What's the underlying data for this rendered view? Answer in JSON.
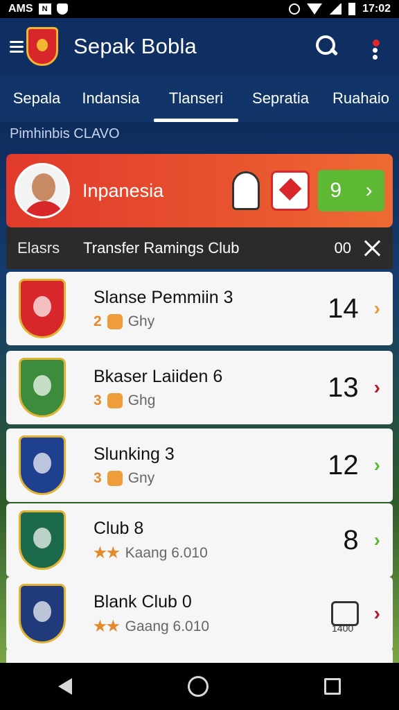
{
  "status_bar": {
    "carrier": "AMS",
    "time": "17:02",
    "box_icon_letter": "N"
  },
  "app_bar": {
    "title": "Sepak Bobla"
  },
  "tabs": [
    {
      "label": "Sepala"
    },
    {
      "label": "Indansia"
    },
    {
      "label": "Tlanseri",
      "active": true
    },
    {
      "label": "Sepratia"
    },
    {
      "label": "Ruahaio"
    }
  ],
  "section_label": "Pimhinbis CLAVO",
  "featured": {
    "title": "Inpanesia",
    "action_icon": "9",
    "chevron": "›"
  },
  "strip": {
    "tag": "Elasrs",
    "title": "Transfer Ramings Club",
    "count": "00"
  },
  "items": [
    {
      "name": "Slanse Pemmiin 3",
      "meta_num": "2",
      "meta_text": "Ghy",
      "score": "14",
      "chevron": "›",
      "chevron_color": "#e29a3b"
    },
    {
      "name": "Bkaser Laiiden 6",
      "meta_num": "3",
      "meta_text": "Ghg",
      "score": "13",
      "chevron": "›",
      "chevron_color": "#b1182a"
    },
    {
      "name": "Slunking 3",
      "meta_num": "3",
      "meta_text": "Gny",
      "score": "12",
      "chevron": "›",
      "chevron_color": "#5db833"
    },
    {
      "name": "Club 8",
      "meta_num": "★★",
      "meta_text": "Kaang 6.010",
      "score": "8",
      "chevron": "›",
      "chevron_color": "#5db833"
    },
    {
      "name": "Blank Club 0",
      "meta_num": "★★",
      "meta_text": "Gaang 6.010",
      "score": "1400",
      "chevron": "›",
      "chevron_color": "#b1182a"
    }
  ],
  "colors": {
    "brand": "#0f2f63",
    "accent_red": "#e13a2c",
    "accent_green": "#5db833"
  }
}
